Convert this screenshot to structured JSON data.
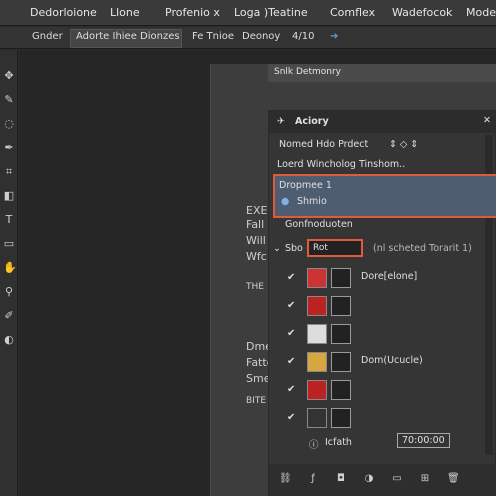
{
  "menubar": {
    "items": [
      "Dedorloione",
      "Llone",
      "Profenio x",
      "Loga )Teatine",
      "Comflex",
      "Wadefocok",
      "Mode"
    ]
  },
  "optbar": {
    "items": [
      "Gnder",
      "Adorte Ihiee Dionzes",
      "Fe Tnioe",
      "Deonoy",
      "4/10"
    ]
  },
  "doc": {
    "title": "Snlk Detmonry",
    "side_texts": [
      "EXE",
      "Fall",
      "Will",
      "Wfc",
      "THE",
      "Dme",
      "Fatte",
      "Sme",
      "BITE"
    ]
  },
  "panel": {
    "title": "Aciory",
    "rows": {
      "r1": "Nomed Hdo Prdect",
      "r2": "Loerd Wincholog Tinshom..",
      "sel_line1": "Dropmee 1",
      "sel_line2": "Shmio",
      "group_header": "Gonfnoduoten",
      "filter_label": "Sbo",
      "filter_value": "Rot",
      "filter_hint": "(nl scheted Torarit 1)"
    },
    "layers": [
      {
        "name": "Dore[elone]"
      },
      {
        "name": ""
      },
      {
        "name": ""
      },
      {
        "name": "Dom(Ucucle)"
      },
      {
        "name": ""
      },
      {
        "name": ""
      }
    ],
    "footer": {
      "text": "Icfath",
      "value": "70:00:00"
    }
  }
}
